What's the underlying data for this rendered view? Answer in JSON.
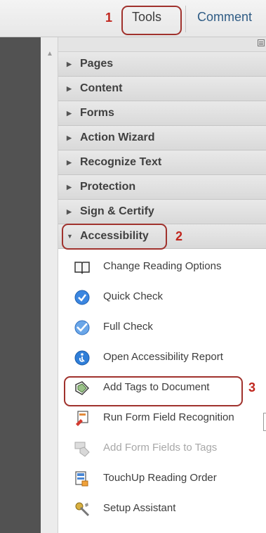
{
  "tabs": {
    "tools": "Tools",
    "comment": "Comment"
  },
  "callouts": [
    "1",
    "2",
    "3"
  ],
  "sections": [
    {
      "label": "Pages"
    },
    {
      "label": "Content"
    },
    {
      "label": "Forms"
    },
    {
      "label": "Action Wizard"
    },
    {
      "label": "Recognize Text"
    },
    {
      "label": "Protection"
    },
    {
      "label": "Sign & Certify"
    },
    {
      "label": "Accessibility"
    }
  ],
  "tools": [
    {
      "label": "Change Reading Options",
      "icon": "book-icon"
    },
    {
      "label": "Quick Check",
      "icon": "checkmark-icon"
    },
    {
      "label": "Full Check",
      "icon": "full-check-icon"
    },
    {
      "label": "Open Accessibility Report",
      "icon": "accessibility-report-icon"
    },
    {
      "label": "Add Tags to Document",
      "icon": "tag-icon"
    },
    {
      "label": "Run Form Field Recognition",
      "icon": "form-recognition-icon"
    },
    {
      "label": "Add Form Fields to Tags",
      "icon": "form-fields-tags-icon",
      "disabled": true
    },
    {
      "label": "TouchUp Reading Order",
      "icon": "reading-order-icon"
    },
    {
      "label": "Setup Assistant",
      "icon": "setup-assistant-icon"
    }
  ],
  "colors": {
    "callout": "#c0261e",
    "comment_tab": "#2f5c85",
    "checkmark": "#2f7ed8"
  }
}
